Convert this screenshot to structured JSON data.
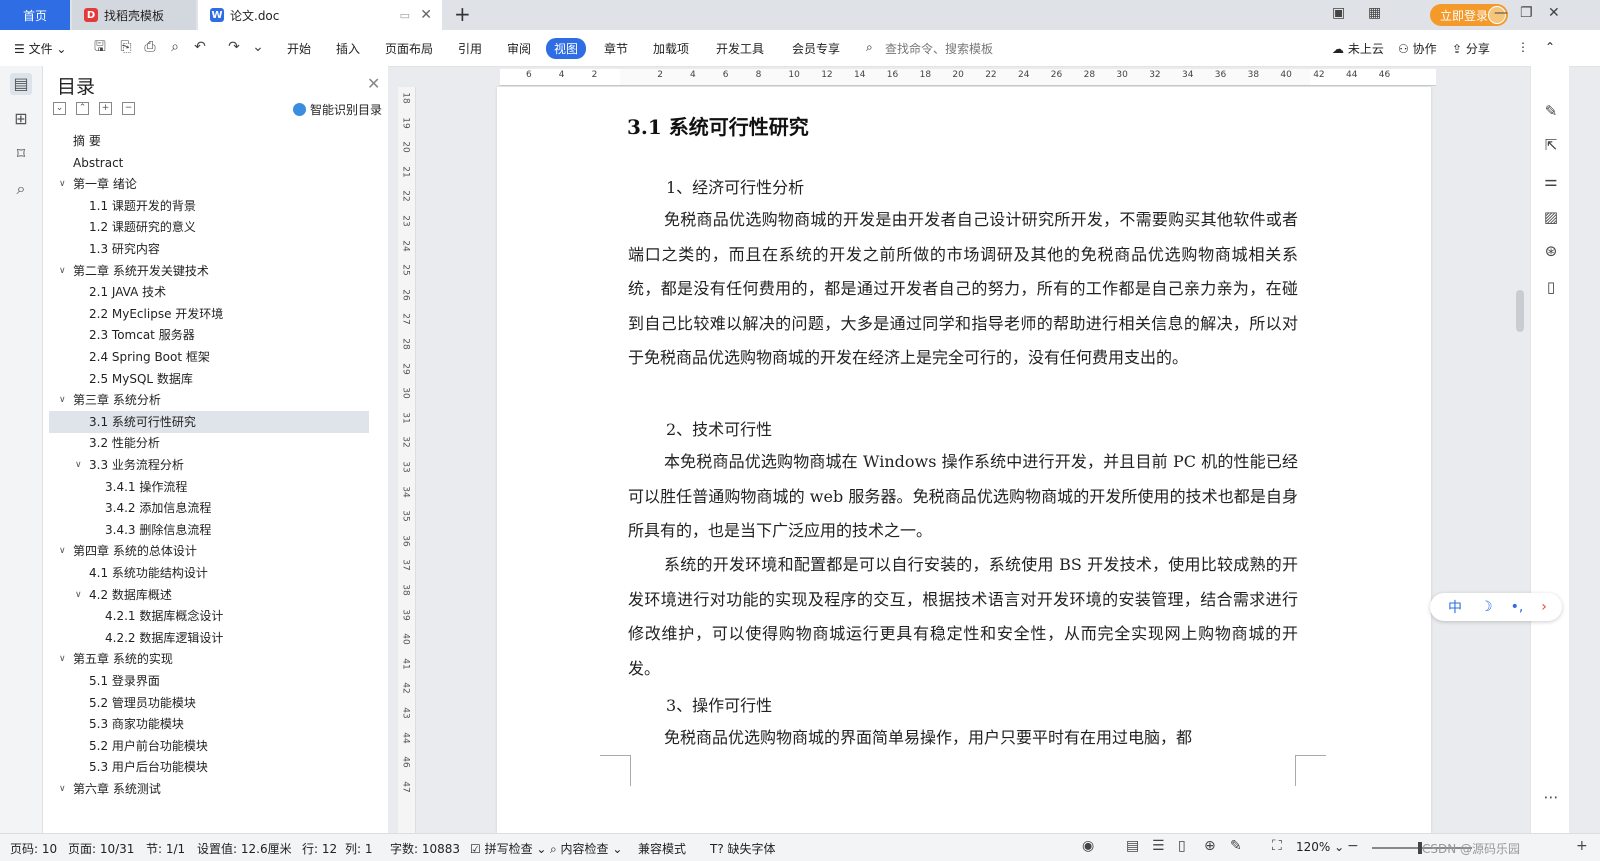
{
  "tabs": {
    "home": "首页",
    "template": "找稻壳模板",
    "document": "论文.doc",
    "login": "立即登录"
  },
  "menu": {
    "file": "文件",
    "items": [
      "开始",
      "插入",
      "页面布局",
      "引用",
      "审阅",
      "视图",
      "章节",
      "加载项",
      "开发工具",
      "会员专享"
    ],
    "active": "视图",
    "search_placeholder": "查找命令、搜索模板",
    "cloud": "未上云",
    "collab": "协作",
    "share": "分享"
  },
  "toc": {
    "title": "目录",
    "smart": "智能识别目录",
    "items": [
      {
        "text": "摘  要",
        "level": 0,
        "chev": ""
      },
      {
        "text": "Abstract",
        "level": 0,
        "chev": ""
      },
      {
        "text": "第一章  绪论",
        "level": 0,
        "chev": "v"
      },
      {
        "text": "1.1  课题开发的背景",
        "level": 1,
        "chev": ""
      },
      {
        "text": "1.2  课题研究的意义",
        "level": 1,
        "chev": ""
      },
      {
        "text": "1.3  研究内容",
        "level": 1,
        "chev": ""
      },
      {
        "text": "第二章  系统开发关键技术",
        "level": 0,
        "chev": "v"
      },
      {
        "text": "2.1 JAVA 技术",
        "level": 1,
        "chev": ""
      },
      {
        "text": "2.2 MyEclipse 开发环境",
        "level": 1,
        "chev": ""
      },
      {
        "text": "2.3 Tomcat 服务器",
        "level": 1,
        "chev": ""
      },
      {
        "text": "2.4 Spring   Boot 框架",
        "level": 1,
        "chev": ""
      },
      {
        "text": "2.5 MySQL 数据库",
        "level": 1,
        "chev": ""
      },
      {
        "text": "第三章  系统分析",
        "level": 0,
        "chev": "v"
      },
      {
        "text": "3.1  系统可行性研究",
        "level": 1,
        "chev": "",
        "active": true
      },
      {
        "text": "3.2  性能分析",
        "level": 1,
        "chev": ""
      },
      {
        "text": "3.3  业务流程分析",
        "level": 1,
        "chev": "v"
      },
      {
        "text": "3.4.1 操作流程",
        "level": 2,
        "chev": ""
      },
      {
        "text": "3.4.2 添加信息流程",
        "level": 2,
        "chev": ""
      },
      {
        "text": "3.4.3 删除信息流程",
        "level": 2,
        "chev": ""
      },
      {
        "text": "第四章  系统的总体设计",
        "level": 0,
        "chev": "v"
      },
      {
        "text": "4.1  系统功能结构设计",
        "level": 1,
        "chev": ""
      },
      {
        "text": "4.2  数据库概述",
        "level": 1,
        "chev": "v"
      },
      {
        "text": "4.2.1  数据库概念设计",
        "level": 2,
        "chev": ""
      },
      {
        "text": "4.2.2  数据库逻辑设计",
        "level": 2,
        "chev": ""
      },
      {
        "text": "第五章  系统的实现",
        "level": 0,
        "chev": "v"
      },
      {
        "text": "5.1 登录界面",
        "level": 1,
        "chev": ""
      },
      {
        "text": "5.2 管理员功能模块",
        "level": 1,
        "chev": ""
      },
      {
        "text": "5.3 商家功能模块",
        "level": 1,
        "chev": ""
      },
      {
        "text": "5.2 用户前台功能模块",
        "level": 1,
        "chev": ""
      },
      {
        "text": "5.3 用户后台功能模块",
        "level": 1,
        "chev": ""
      },
      {
        "text": "第六章  系统测试",
        "level": 0,
        "chev": "v"
      }
    ]
  },
  "ruler": {
    "h_ticks": [
      "6",
      "4",
      "2",
      "",
      "2",
      "4",
      "6",
      "8",
      "10",
      "12",
      "14",
      "16",
      "18",
      "20",
      "22",
      "24",
      "26",
      "28",
      "30",
      "32",
      "34",
      "36",
      "38",
      "40",
      "42",
      "44",
      "46"
    ],
    "v_ticks": [
      "18",
      "19",
      "20",
      "21",
      "22",
      "23",
      "24",
      "25",
      "26",
      "27",
      "28",
      "29",
      "30",
      "31",
      "32",
      "33",
      "34",
      "35",
      "36",
      "37",
      "38",
      "39",
      "40",
      "41",
      "42",
      "43",
      "44",
      "46",
      "47"
    ]
  },
  "document": {
    "heading": "3.1  系统可行性研究",
    "sub1": "1、经济可行性分析",
    "p1": "免税商品优选购物商城的开发是由开发者自己设计研究所开发，不需要购买其他软件或者端口之类的，而且在系统的开发之前所做的市场调研及其他的免税商品优选购物商城相关系统，都是没有任何费用的，都是通过开发者自己的努力，所有的工作都是自己亲力亲为，在碰到自己比较难以解决的问题，大多是通过同学和指导老师的帮助进行相关信息的解决，所以对于免税商品优选购物商城的开发在经济上是完全可行的，没有任何费用支出的。",
    "sub2": "2、技术可行性",
    "p2": "本免税商品优选购物商城在 Windows 操作系统中进行开发，并且目前 PC 机的性能已经可以胜任普通购物商城的 web 服务器。免税商品优选购物商城的开发所使用的技术也都是自身所具有的，也是当下广泛应用的技术之一。",
    "p3": "系统的开发环境和配置都是可以自行安装的，系统使用 BS 开发技术，使用比较成熟的开发环境进行对功能的实现及程序的交互，根据技术语言对开发环境的安装管理，结合需求进行修改维护，可以使得购物商城运行更具有稳定性和安全性，从而完全实现网上购物商城的开发。",
    "sub3": "3、操作可行性",
    "p4": "免税商品优选购物商城的界面简单易操作，用户只要平时有在用过电脑，都"
  },
  "ime": {
    "lang": "中",
    "moon": "☽",
    "punct": "•,",
    "arrow": "›"
  },
  "status": {
    "page_code": "页码: 10",
    "page": "页面: 10/31",
    "section": "节: 1/1",
    "setting": "设置值: 12.6厘米",
    "row": "行: 12",
    "col": "列: 1",
    "words": "字数: 10883",
    "spell": "拼写检查",
    "content": "内容检查",
    "compat": "兼容模式",
    "missing_font": "缺失字体",
    "zoom": "120%",
    "watermark": "CSDN @源码乐园"
  },
  "colors": {
    "accent": "#2e6de3",
    "login": "#f39a2b"
  }
}
